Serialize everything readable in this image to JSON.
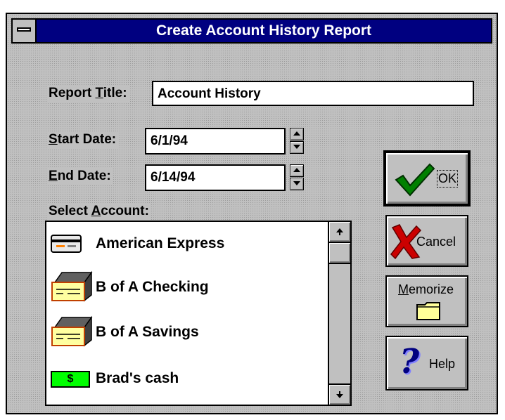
{
  "window": {
    "title": "Create Account History Report"
  },
  "form": {
    "report_title": {
      "label_pre": "Report ",
      "label_key": "T",
      "label_post": "itle:",
      "value": "Account History"
    },
    "start_date": {
      "label_pre": "",
      "label_key": "S",
      "label_post": "tart Date:",
      "value": "6/1/94"
    },
    "end_date": {
      "label_pre": "",
      "label_key": "E",
      "label_post": "nd Date:",
      "value": "6/14/94"
    },
    "select_account": {
      "label_pre": "Select ",
      "label_key": "A",
      "label_post": "ccount:"
    }
  },
  "accounts": [
    {
      "name": "American Express",
      "icon": "credit-card-icon"
    },
    {
      "name": "B of A Checking",
      "icon": "bank-checkbook-icon"
    },
    {
      "name": "B of A Savings",
      "icon": "bank-checkbook-icon"
    },
    {
      "name": "Brad's cash",
      "icon": "cash-icon",
      "icon_text": "$"
    }
  ],
  "buttons": {
    "ok": {
      "label": "OK",
      "icon": "checkmark-icon"
    },
    "cancel": {
      "label": "Cancel",
      "icon": "x-icon"
    },
    "memorize": {
      "label_key": "M",
      "label_post": "emorize",
      "icon": "folder-icon"
    },
    "help": {
      "label": "Help",
      "icon": "question-mark-icon"
    }
  },
  "colors": {
    "titlebar": "#000080",
    "dialog_face": "#c0c0c0",
    "cash_icon": "#00ff00",
    "ok_check": "#008000",
    "cancel_x": "#cc0000",
    "help_question": "#000080",
    "folder": "#ffff99"
  }
}
